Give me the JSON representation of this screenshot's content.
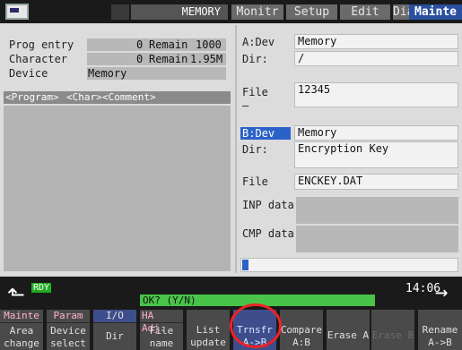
{
  "header": {
    "mode": "MEMORY",
    "tabs": [
      "Monitr",
      "Setup",
      "Edit",
      "Diagn",
      "Mainte"
    ],
    "active_tab": "Mainte"
  },
  "left": {
    "prog_entry_label": "Prog entry",
    "prog_entry_value": "0",
    "prog_remain_label": "Remain",
    "prog_remain_value": "1000",
    "char_label": "Character",
    "char_value": "0",
    "char_remain_label": "Remain",
    "char_remain_value": "1.95M",
    "device_label": "Device",
    "device_value": "Memory",
    "list_headers": [
      "<Program>",
      "<Char>",
      "<Comment>"
    ]
  },
  "right": {
    "a_dev_label": "A:Dev",
    "a_dev_value": "Memory",
    "a_dir_label": "Dir:",
    "a_dir_value": "/",
    "a_file_label": "File",
    "a_file_value": "12345",
    "a_dash": "–",
    "b_dev_label": "B:Dev",
    "b_dev_value": "Memory",
    "b_dir_label": "Dir:",
    "b_dir_value": "Encryption Key",
    "b_file_label": "File",
    "b_file_value": "ENCKEY.DAT",
    "inp_label": "INP data:",
    "cmp_label": "CMP data:",
    "progress_fraction": 0.03
  },
  "status": {
    "ready": "RDY",
    "prompt": "OK? (Y/N)",
    "time": "14:06"
  },
  "softkeys": {
    "mainte": "Mainte",
    "param": "Param",
    "io": "I/O",
    "ha_adj": "HA Adj.",
    "area_change_1": "Area",
    "area_change_2": "change",
    "device_select_1": "Device",
    "device_select_2": "select",
    "dir": "Dir",
    "file_name_1": "File",
    "file_name_2": "name",
    "list_update_1": "List",
    "list_update_2": "update",
    "trnsfr_1": "Trnsfr",
    "trnsfr_2": "A->B",
    "compare_1": "Compare",
    "compare_2": "A:B",
    "erase_a": "Erase A",
    "erase_b": "Erase B",
    "rename_1": "Rename",
    "rename_2": "A->B"
  }
}
